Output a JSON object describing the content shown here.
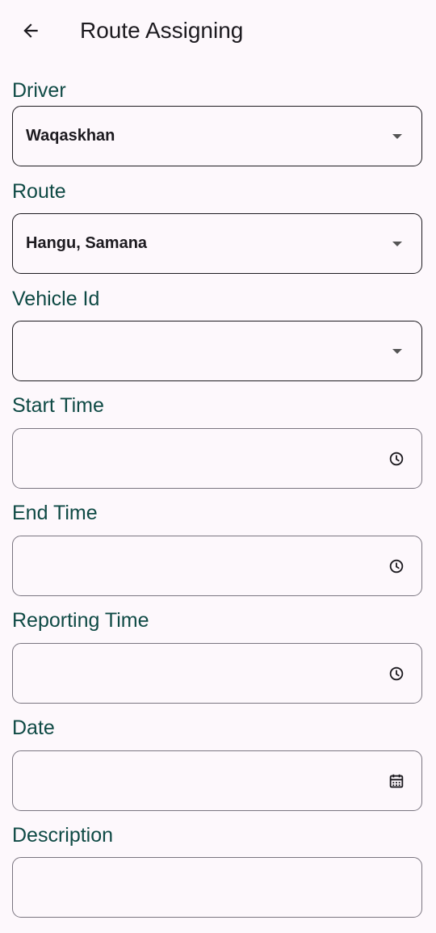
{
  "appbar": {
    "title": "Route Assigning",
    "back_icon": "arrow-back-icon"
  },
  "fields": {
    "driver": {
      "label": "Driver",
      "value": "Waqaskhan"
    },
    "route": {
      "label": "Route",
      "value": "Hangu, Samana"
    },
    "vehicle": {
      "label": "Vehicle Id",
      "value": ""
    },
    "start_time": {
      "label": "Start Time",
      "value": "",
      "icon": "clock-icon"
    },
    "end_time": {
      "label": "End Time",
      "value": "",
      "icon": "clock-icon"
    },
    "reporting_time": {
      "label": "Reporting Time",
      "value": "",
      "icon": "clock-icon"
    },
    "date": {
      "label": "Date",
      "value": "",
      "icon": "calendar-icon"
    },
    "description": {
      "label": "Description",
      "value": ""
    }
  },
  "colors": {
    "label": "#0f4a45",
    "background": "#fdf8fc",
    "text": "#1d1b20"
  }
}
